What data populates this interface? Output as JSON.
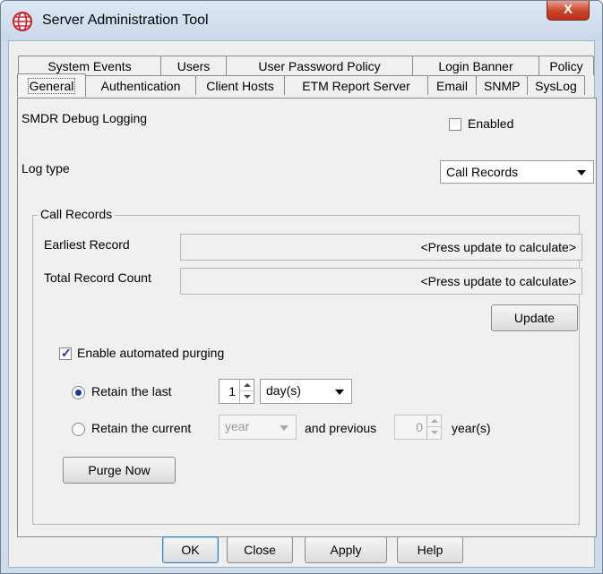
{
  "window": {
    "title": "Server Administration Tool",
    "close_symbol": "X"
  },
  "tabs": {
    "row1": [
      "System Events",
      "Users",
      "User Password Policy",
      "Login Banner",
      "Policy"
    ],
    "row2": [
      "General",
      "Authentication",
      "Client Hosts",
      "ETM Report Server",
      "Email",
      "SNMP",
      "SysLog"
    ],
    "active": "General"
  },
  "general": {
    "smdr_label": "SMDR Debug Logging",
    "enabled_label": "Enabled",
    "enabled_checked": false,
    "log_type_label": "Log type",
    "log_type_value": "Call Records",
    "group_title": "Call Records",
    "earliest_label": "Earliest Record",
    "earliest_value": "<Press update to calculate>",
    "total_label": "Total Record Count",
    "total_value": "<Press update to calculate>",
    "update_label": "Update",
    "auto_purge_label": "Enable automated purging",
    "auto_purge_checked": true,
    "retain_last_label": "Retain the last",
    "retain_last_value": "1",
    "retain_last_unit": "day(s)",
    "retain_current_label": "Retain the current",
    "retain_current_unit": "year",
    "and_previous_label": "and previous",
    "previous_value": "0",
    "previous_unit": "year(s)",
    "purge_now_label": "Purge Now"
  },
  "footer": {
    "ok": "OK",
    "close": "Close",
    "apply": "Apply",
    "help": "Help"
  }
}
